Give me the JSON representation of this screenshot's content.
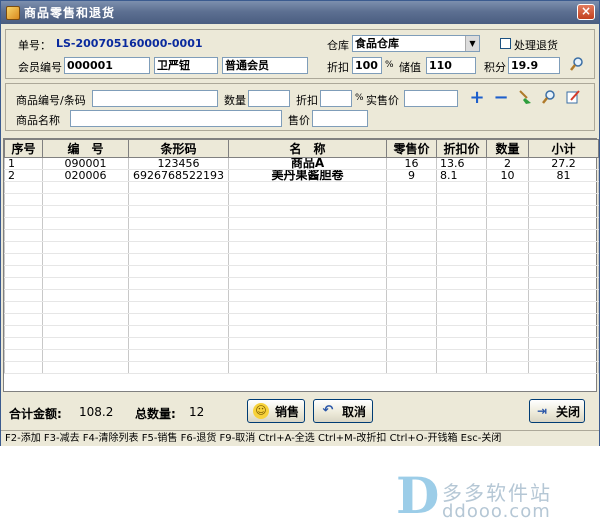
{
  "window": {
    "title": "商品零售和退货",
    "close_label": "×"
  },
  "header": {
    "order_no_label": "单号：",
    "order_no_value": "LS-200705160000-0001",
    "warehouse_label": "仓库",
    "warehouse_value": "食品仓库",
    "return_label": "处理退货",
    "member_no_label": "会员编号",
    "member_no_value": "000001",
    "member_name": "卫严钮",
    "member_level": "普通会员",
    "discount_label": "折扣",
    "discount_value": "100",
    "percent": "%",
    "stored_label": "储值",
    "stored_value": "110",
    "points_label": "积分",
    "points_value": "19.9"
  },
  "entry": {
    "code_label": "商品编号/条码",
    "qty_label": "数量",
    "discount_label": "折扣",
    "percent": "%",
    "actual_price_label": "实售价",
    "name_label": "商品名称",
    "price_label": "售价"
  },
  "table": {
    "columns": [
      "序号",
      "编　号",
      "条形码",
      "名　称",
      "零售价",
      "折扣价",
      "数量",
      "小计"
    ],
    "rows": [
      [
        "1",
        "090001",
        "123456",
        "商品A",
        "16",
        "13.6",
        "2",
        "27.2"
      ],
      [
        "2",
        "020006",
        "6926768522193",
        "美丹果酱胆卷",
        "9",
        "8.1",
        "10",
        "81"
      ]
    ]
  },
  "watermark": {
    "cn": "多多软件站",
    "url": "ddooo.com"
  },
  "footer": {
    "total_amount_label": "合计金额:",
    "total_amount_value": "108.2",
    "total_qty_label": "总数量:",
    "total_qty_value": "12",
    "sell_button": "销售",
    "cancel_button": "取消",
    "close_button": "关闭"
  },
  "statusbar": {
    "text": "F2-添加  F3-减去  F4-清除列表  F5-销售  F6-退货  F9-取消  Ctrl+A-全选  Ctrl+M-改折扣  Ctrl+O-开钱箱  Esc-关闭"
  }
}
